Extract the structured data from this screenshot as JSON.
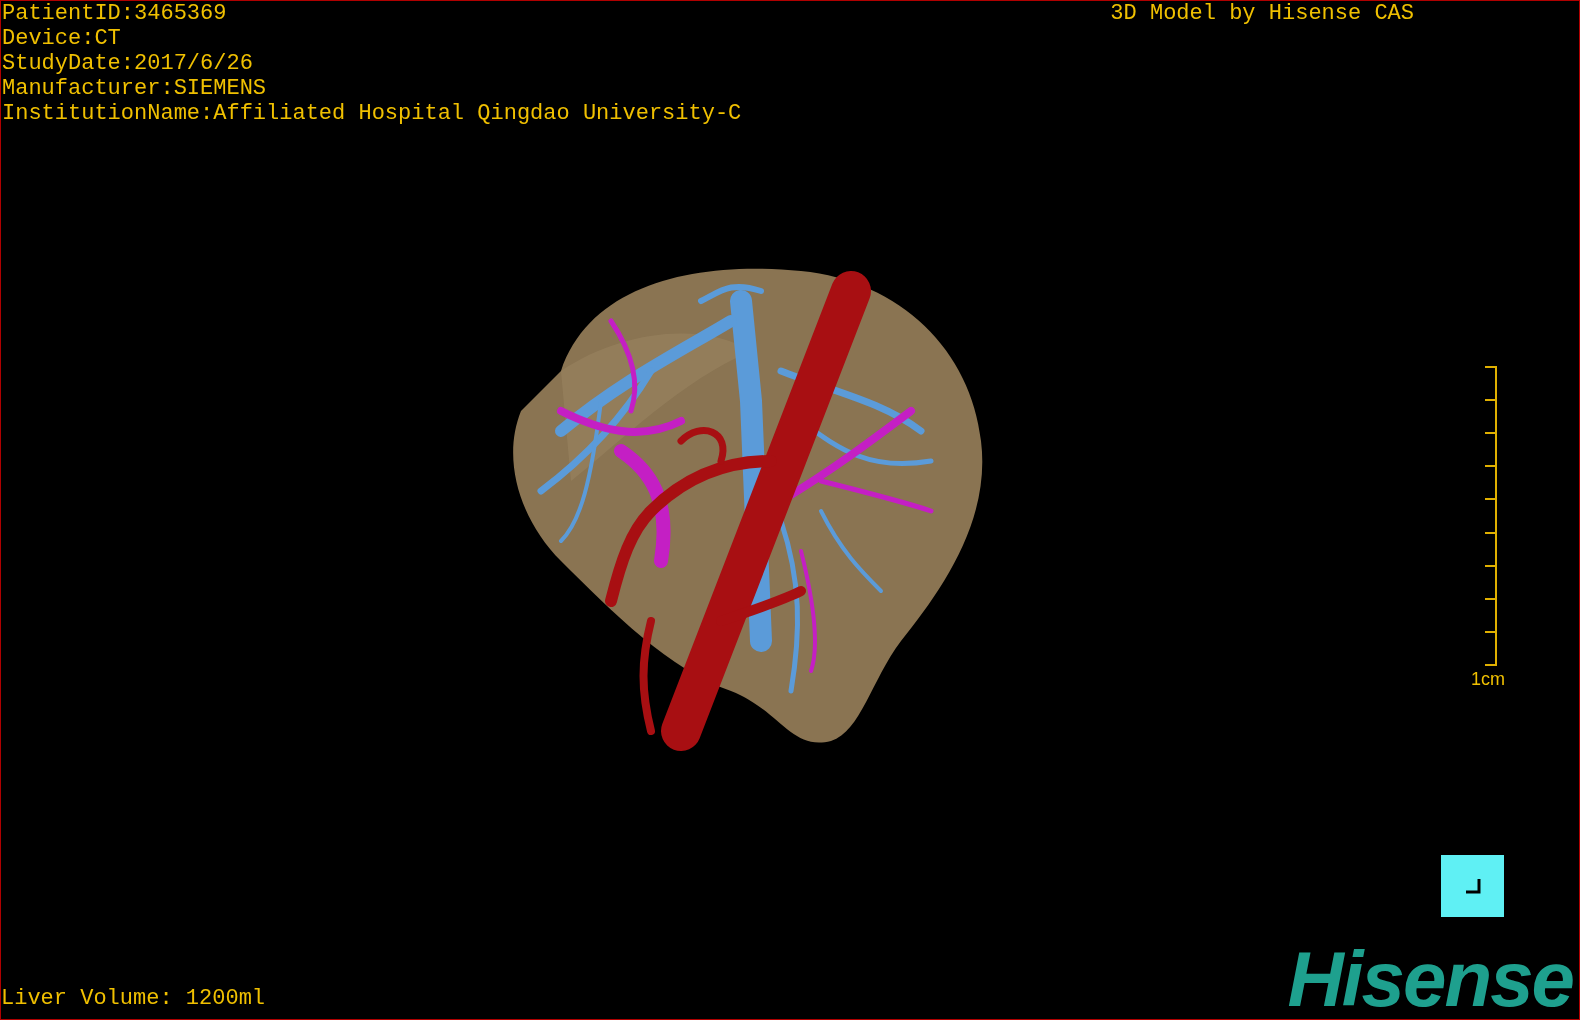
{
  "header": {
    "info_lines": [
      "PatientID:3465369",
      "Device:CT",
      "StudyDate:2017/6/26",
      "Manufacturer:SIEMENS",
      "InstitutionName:Affiliated Hospital Qingdao University-C"
    ],
    "model_credit": "3D Model by Hisense CAS"
  },
  "scale_bar": {
    "label": "1cm"
  },
  "footer": {
    "liver_volume": "Liver Volume: 1200ml",
    "logo": "Hisense"
  }
}
